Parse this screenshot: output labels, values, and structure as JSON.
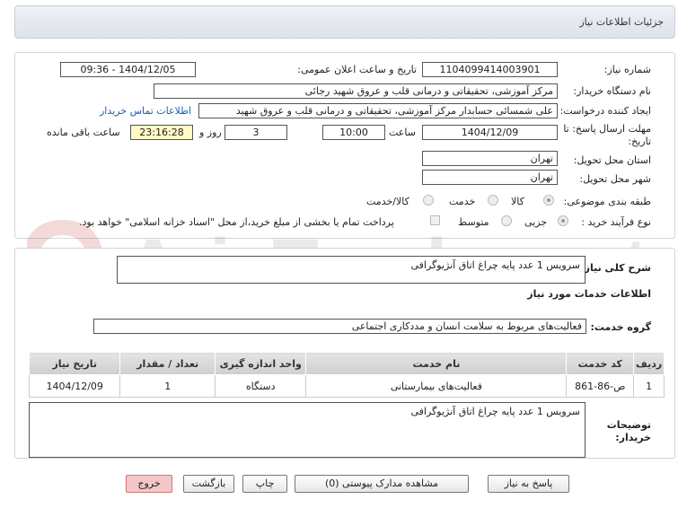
{
  "header": {
    "title": "جزئیات اطلاعات نیاز"
  },
  "form": {
    "need_number_label": "شماره نیاز:",
    "need_number": "1104099414003901",
    "announce_label": "تاریخ و ساعت اعلان عمومی:",
    "announce_value": "1404/12/05 - 09:36",
    "buyer_label": "نام دستگاه خریدار:",
    "buyer_value": "مرکز آموزشی، تحقیقاتی و درمانی قلب و عروق شهید رجائی",
    "creator_label": "ایجاد کننده درخواست:",
    "creator_value": "علی شمسائی حسابدار مرکز آموزشی، تحقیقاتی و درمانی قلب و عروق شهید",
    "contact_link": "اطلاعات تماس خریدار",
    "deadline_label_1": "مهلت ارسال پاسخ: تا",
    "deadline_label_2": "تاریخ:",
    "deadline_date": "1404/12/09",
    "time_label": "ساعت",
    "deadline_time": "10:00",
    "days_value": "3",
    "days_label": "روز و",
    "remaining_time": "23:16:28",
    "remaining_label": "ساعت باقی مانده",
    "province_label": "استان محل تحویل:",
    "province_value": "تهران",
    "city_label": "شهر محل تحویل:",
    "city_value": "تهران",
    "category_label": "طبقه بندی موضوعی:",
    "category_options": [
      "کالا",
      "خدمت",
      "کالا/خدمت"
    ],
    "purchase_label": "نوع فرآیند خرید :",
    "purchase_options": [
      "جزیی",
      "متوسط"
    ],
    "payment_note": "پرداخت تمام یا بخشی از مبلغ خرید،از محل \"اسناد خزانه اسلامی\" خواهد بود."
  },
  "details": {
    "summary_label": "شرح کلی نیاز:",
    "summary_value": "سرویس 1 عدد پایه چراغ اتاق آنژیوگرافی",
    "services_title": "اطلاعات خدمات مورد نیاز",
    "group_label": "گروه خدمت:",
    "group_value": "فعالیت‌های مربوط به سلامت انسان و مددکاری اجتماعی"
  },
  "table": {
    "headers": [
      "ردیف",
      "کد خدمت",
      "نام خدمت",
      "واحد اندازه گیری",
      "تعداد / مقدار",
      "تاریخ نیاز"
    ],
    "rows": [
      [
        "1",
        "ص-86-861",
        "فعالیت‌های بیمارستانی",
        "دستگاه",
        "1",
        "1404/12/09"
      ]
    ]
  },
  "buyer_notes": {
    "label_1": "توضیحات",
    "label_2": "خریدار:",
    "value": "سرویس 1 عدد پایه چراغ اتاق آنژیوگرافی"
  },
  "buttons": {
    "reply": "پاسخ به نیاز",
    "view_docs": "مشاهده مدارک پیوستی (0)",
    "print": "چاپ",
    "back": "بازگشت",
    "exit": "خروج"
  },
  "watermark": {
    "text": "AriaTender.net"
  },
  "colors": {
    "link": "#1a5fb4",
    "highlight": "#fff9c4",
    "exit_button": "#f4c7c7"
  }
}
